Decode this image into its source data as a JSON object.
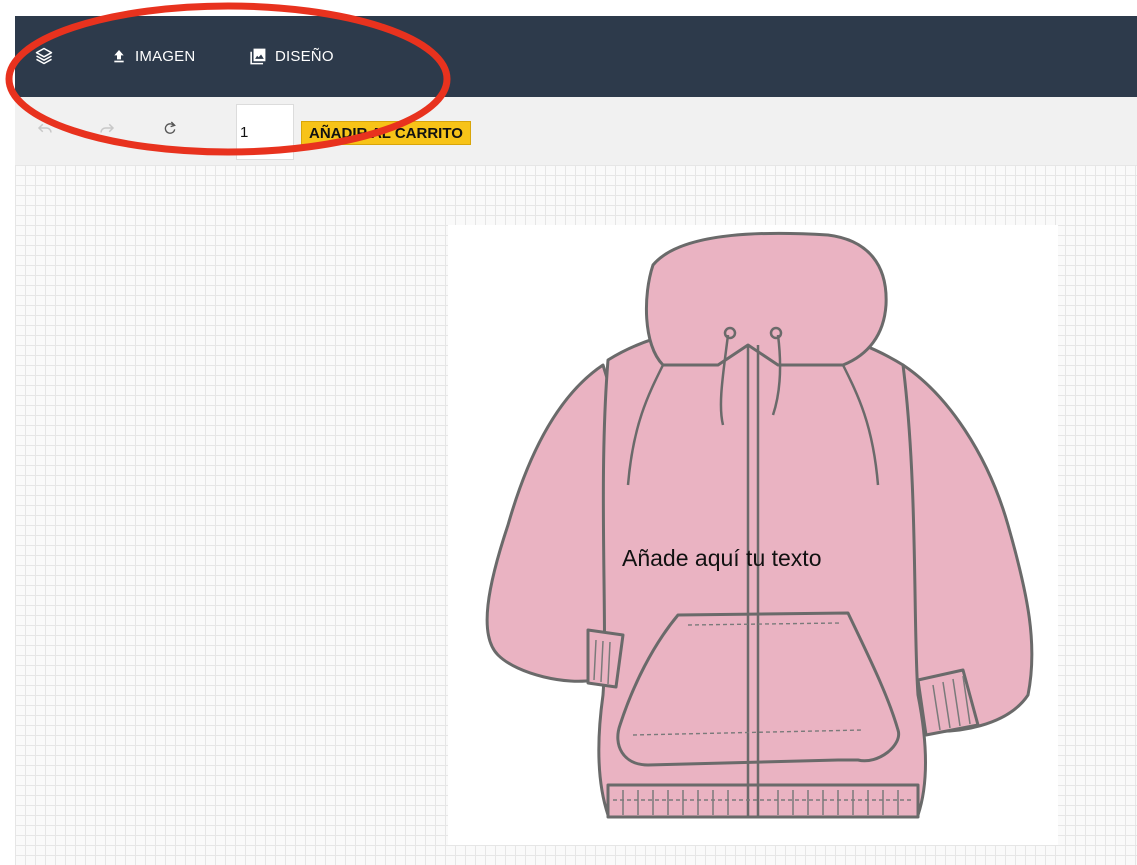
{
  "topbar": {
    "background": "#2d3a4b",
    "items": [
      {
        "icon": "layers-icon"
      },
      {
        "icon": "upload-icon",
        "label": "IMAGEN"
      },
      {
        "icon": "image-icon",
        "label": "DISEÑO"
      }
    ]
  },
  "toolbar": {
    "undo_icon": "undo-icon",
    "redo_icon": "redo-icon",
    "reset_icon": "refresh-icon",
    "quantity_value": "1",
    "add_to_cart_label": "AÑADIR AL CARRITO",
    "add_to_cart_color": "#f7c318"
  },
  "canvas": {
    "product": "pink-hoodie",
    "product_color": "#eab3c2",
    "design_text": "Añade aquí tu texto"
  },
  "annotation": {
    "shape": "ellipse",
    "color": "#e8321e"
  }
}
